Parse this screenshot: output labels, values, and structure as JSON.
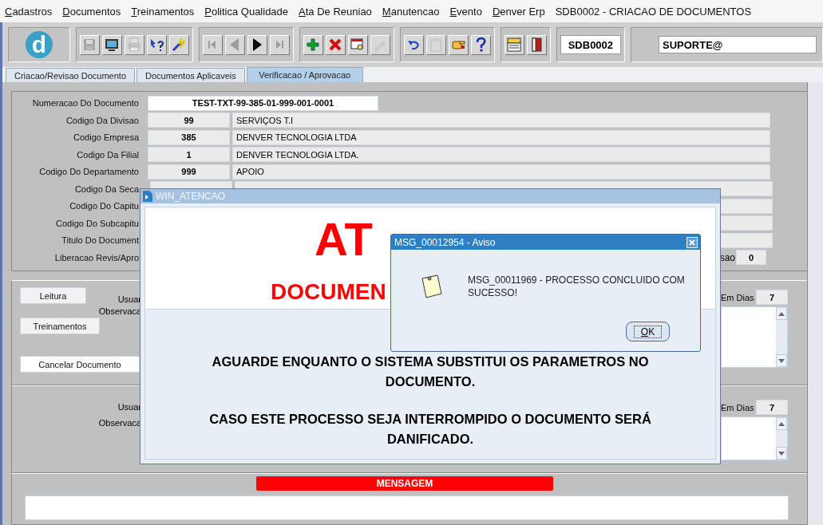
{
  "menu": {
    "items": [
      "Cadastros",
      "Documentos",
      "Treinamentos",
      "Politica Qualidade",
      "Ata De Reuniao",
      "Manutencao",
      "Evento",
      "Denver Erp"
    ],
    "form_title": "SDB0002 - CRIACAO DE DOCUMENTOS"
  },
  "toolbar": {
    "logo": "d",
    "groups": [
      [
        {
          "kind": "save",
          "disabled": true
        },
        {
          "kind": "monitor",
          "disabled": false
        },
        {
          "kind": "printer",
          "disabled": true
        },
        {
          "kind": "help-pointer",
          "disabled": false
        },
        {
          "kind": "wand",
          "disabled": false
        }
      ],
      [
        {
          "kind": "first",
          "disabled": true
        },
        {
          "kind": "previous",
          "disabled": true
        },
        {
          "kind": "next",
          "disabled": false
        },
        {
          "kind": "last",
          "disabled": true
        }
      ],
      [
        {
          "kind": "add",
          "disabled": false
        },
        {
          "kind": "delete",
          "disabled": false
        },
        {
          "kind": "find",
          "disabled": false
        },
        {
          "kind": "edit",
          "disabled": true
        }
      ],
      [
        {
          "kind": "undo",
          "disabled": false
        },
        {
          "kind": "clipboard",
          "disabled": true
        },
        {
          "kind": "hand",
          "disabled": false
        },
        {
          "kind": "help",
          "disabled": false
        }
      ],
      [
        {
          "kind": "menu",
          "disabled": false
        },
        {
          "kind": "exit",
          "disabled": false
        }
      ]
    ],
    "form_code": "SDB0002",
    "user": "SUPORTE@"
  },
  "tabs": [
    {
      "label": "Criacao/Revisao Documento",
      "selected": false
    },
    {
      "label": "Documentos Aplicaveis",
      "selected": false
    },
    {
      "label": "Verificacao / Aprovacao",
      "selected": true
    }
  ],
  "document_form": {
    "number_label": "Numeracao Do Documento",
    "number": "TEST-TXT-99-385-01-999-001-0001",
    "rows": [
      {
        "label": "Codigo Da Divisao",
        "code": "99",
        "name": "SERVIÇOS T.I"
      },
      {
        "label": "Codigo Empresa",
        "code": "385",
        "name": "DENVER TECNOLOGIA LTDA"
      },
      {
        "label": "Codigo Da Filial",
        "code": "1",
        "name": "DENVER TECNOLOGIA LTDA."
      },
      {
        "label": "Codigo Do Departamento",
        "code": "999",
        "name": "APOIO"
      },
      {
        "label": "Codigo Da Seca"
      },
      {
        "label": "Codigo Do Capitu"
      },
      {
        "label": "Codigo Do Subcapitu"
      },
      {
        "label": "Titulo Do Document"
      }
    ],
    "release": {
      "label": "Liberacao Revis/Apro",
      "extra_label": "sao",
      "value": "0"
    }
  },
  "reading_section": {
    "buttons": [
      "Leitura",
      "Treinamentos"
    ],
    "cancel_button": "Cancelar Documento",
    "user_label": "Usuar",
    "notes_label": "Observaca",
    "days_label": "Em Dias",
    "days": "7"
  },
  "second_section": {
    "user_label": "Usuar",
    "notes_label": "Observaca",
    "days_label": "Em Dias",
    "days": "7"
  },
  "message_bar": {
    "title": "MENSAGEM"
  },
  "attention_window": {
    "title": "WIN_ATENCAO",
    "heading": "AT",
    "subheading": "DOCUMEN",
    "paragraphs": [
      "AGUARDE ENQUANTO O SISTEMA SUBSTITUI OS PARAMETROS NO DOCUMENTO.",
      "CASO ESTE PROCESSO SEJA INTERROMPIDO O DOCUMENTO SERÁ DANIFICADO."
    ]
  },
  "alert": {
    "title": "MSG_00012954 - Aviso",
    "message": "MSG_00011969 - PROCESSO CONCLUIDO COM SUCESSO!",
    "button": "OK"
  }
}
